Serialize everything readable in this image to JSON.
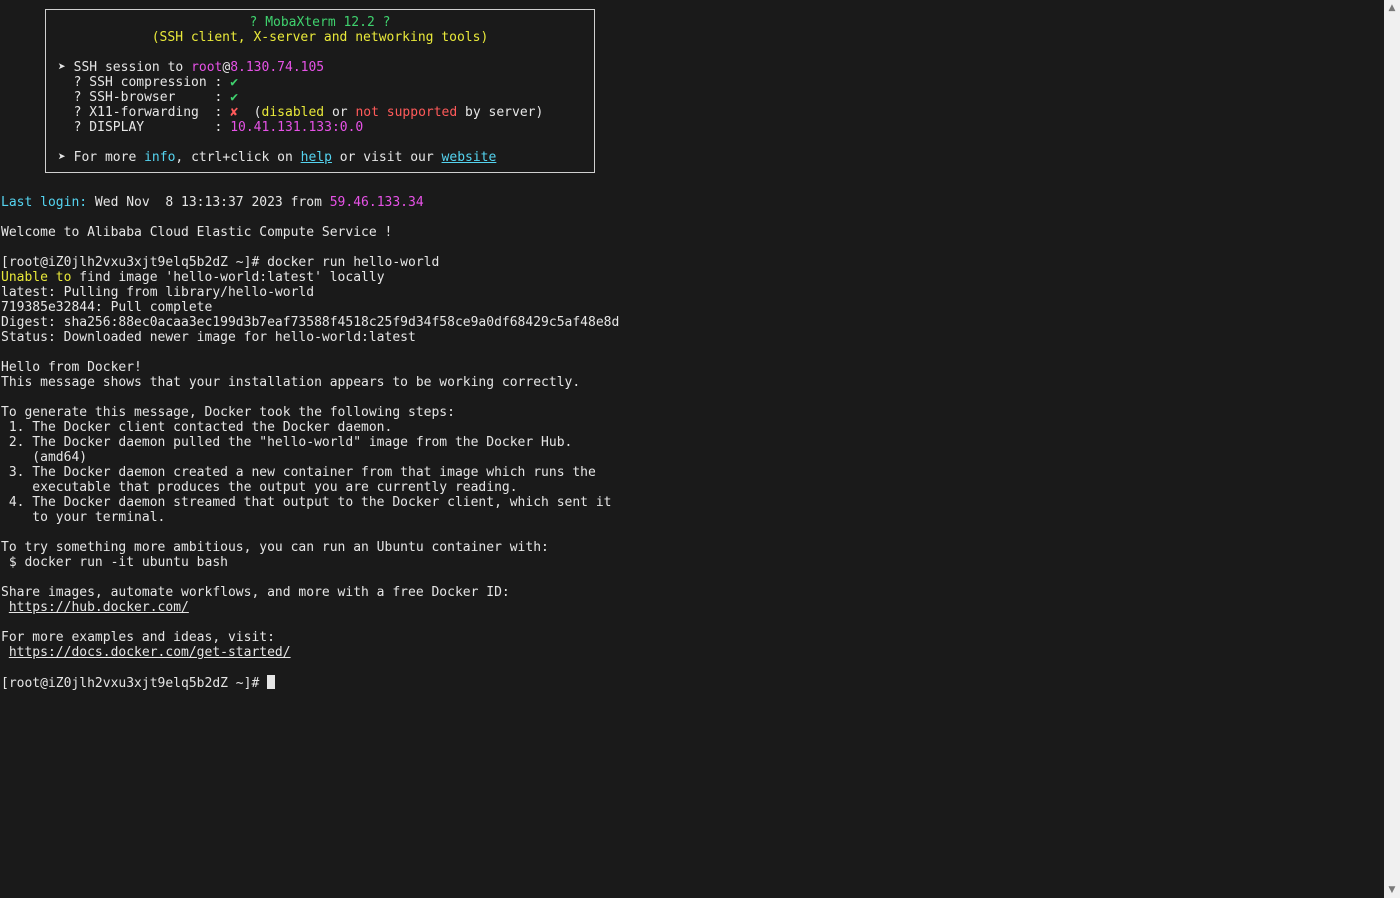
{
  "banner": {
    "title": "? MobaXterm 12.2 ?",
    "subtitle": "(SSH client, X-server and networking tools)",
    "arrow": "➤",
    "session_prefix": "SSH session to ",
    "user": "root",
    "at": "@",
    "host": "8.130.74.105",
    "compression_label": "? SSH compression : ",
    "compression_value": "✔",
    "browser_label": "? SSH-browser     : ",
    "browser_value": "✔",
    "x11_label": "? X11-forwarding  : ",
    "x11_value": "✘",
    "x11_open": "  (",
    "x11_disabled": "disabled",
    "x11_or": " or ",
    "x11_not_supported": "not supported",
    "x11_close": " by server)",
    "display_label": "? DISPLAY         : ",
    "display_value": "10.41.131.133:0.0",
    "more_prefix": "For more ",
    "more_info": "info",
    "more_mid": ", ctrl+click on ",
    "more_help": "help",
    "more_mid2": " or visit our ",
    "more_website": "website"
  },
  "terminal": {
    "last_login_label": "Last login:",
    "last_login_value": " Wed Nov  8 13:13:37 2023 from ",
    "last_login_ip": "59.46.133.34",
    "welcome": "Welcome to Alibaba Cloud Elastic Compute Service !",
    "prompt": "[root@iZ0jlh2vxu3xjt9elq5b2dZ ~]# ",
    "command": "docker run hello-world",
    "unable_word1": "Unable",
    "unable_word2": "to",
    "unable_rest": " find image 'hello-world:latest' locally",
    "output_1": [
      "latest: Pulling from library/hello-world",
      "719385e32844: Pull complete",
      "Digest: sha256:88ec0acaa3ec199d3b7eaf73588f4518c25f9d34f58ce9a0df68429c5af48e8d",
      "Status: Downloaded newer image for hello-world:latest"
    ],
    "output_2": [
      "Hello from Docker!",
      "This message shows that your installation appears to be working correctly."
    ],
    "output_3": [
      "To generate this message, Docker took the following steps:",
      " 1. The Docker client contacted the Docker daemon.",
      " 2. The Docker daemon pulled the \"hello-world\" image from the Docker Hub.",
      "    (amd64)",
      " 3. The Docker daemon created a new container from that image which runs the",
      "    executable that produces the output you are currently reading.",
      " 4. The Docker daemon streamed that output to the Docker client, which sent it",
      "    to your terminal."
    ],
    "output_4": [
      "To try something more ambitious, you can run an Ubuntu container with:",
      " $ docker run -it ubuntu bash"
    ],
    "share_text": "Share images, automate workflows, and more with a free Docker ID:",
    "hub_url": "https://hub.docker.com/",
    "examples_text": "For more examples and ideas, visit:",
    "docs_url": "https://docs.docker.com/get-started/",
    "final_prompt": "[root@iZ0jlh2vxu3xjt9elq5b2dZ ~]# "
  },
  "scrollbar": {
    "up_icon": "▲",
    "down_icon": "▼"
  }
}
